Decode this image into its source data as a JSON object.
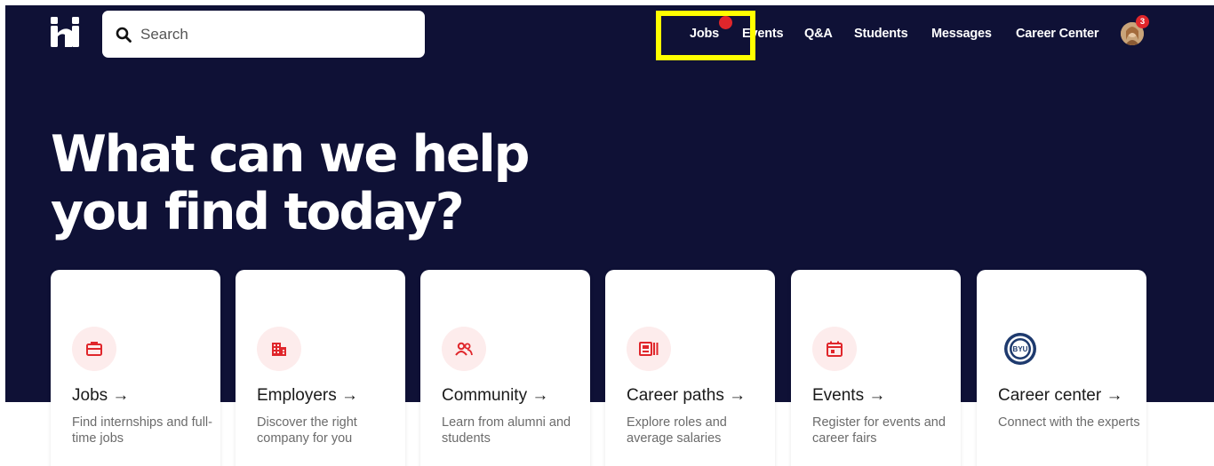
{
  "header": {
    "logo_text": "hi",
    "search": {
      "placeholder": "Search",
      "value": ""
    },
    "nav": [
      {
        "label": "Jobs"
      },
      {
        "label": "Events"
      },
      {
        "label": "Q&A"
      },
      {
        "label": "Students"
      },
      {
        "label": "Messages"
      },
      {
        "label": "Career Center"
      }
    ],
    "avatar_badge": "3"
  },
  "hero": {
    "title_line1": "What can we help",
    "title_line2": "you find today?"
  },
  "cards": [
    {
      "title": "Jobs →",
      "description": "Find internships and full-time jobs",
      "icon": "briefcase-icon"
    },
    {
      "title": "Employers →",
      "description": "Discover the right company for you",
      "icon": "building-icon"
    },
    {
      "title": "Community →",
      "description": "Learn from alumni and students",
      "icon": "people-icon"
    },
    {
      "title": "Career paths →",
      "description": "Explore roles and average salaries",
      "icon": "id-card-icon"
    },
    {
      "title": "Events →",
      "description": "Register for events and career fairs",
      "icon": "calendar-icon"
    },
    {
      "title": "Career center →",
      "description": "Connect with the experts",
      "icon": "university-seal-icon",
      "seal_text": "BYU"
    }
  ],
  "colors": {
    "hero_background": "#0f1136",
    "accent_red": "#e0262b",
    "icon_bg": "#fdecec",
    "highlight": "#ffff00"
  }
}
